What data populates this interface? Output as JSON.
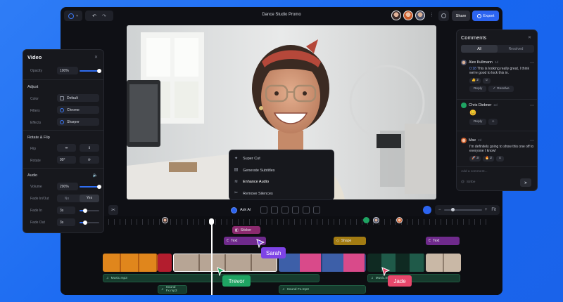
{
  "app": {
    "project_title": "Dance Studio Promo",
    "share_label": "Share",
    "export_label": "Export"
  },
  "ai_menu": {
    "items": [
      {
        "label": "Super Cut",
        "icon": "scissors-sparkle-icon"
      },
      {
        "label": "Generate Subtitles",
        "icon": "subtitles-icon"
      },
      {
        "label": "Enhance Audio",
        "icon": "audio-wave-icon"
      },
      {
        "label": "Remove Silences",
        "icon": "cut-silence-icon"
      }
    ]
  },
  "toolbar": {
    "ask_ai_label": "Ask AI",
    "zoom_minus": "−",
    "zoom_plus": "+",
    "fit_label": "Fit"
  },
  "timeline": {
    "clips": {
      "sticker": "Sticker",
      "text1": "Text",
      "shape": "Shape",
      "text2": "Text",
      "music1": "Music.mp3",
      "music2": "Music.mp3",
      "sfx1": "Sound Fx.mp3",
      "sfx2": "Sound Fx.mp3"
    },
    "cursors": {
      "sarah": "Sarah",
      "trevor": "Trevor",
      "jade": "Jade"
    }
  },
  "video_panel": {
    "title": "Video",
    "opacity_label": "Opacity",
    "opacity_value": "100%",
    "opacity_level": 1.0,
    "adjust_title": "Adjust",
    "color_label": "Color",
    "color_value": "Default",
    "filters_label": "Filters",
    "filters_value": "Chrome",
    "effects_label": "Effects",
    "effects_value": "Sharper",
    "rotate_flip_title": "Rotate & Flip",
    "flip_label": "Flip",
    "rotate_label": "Rotate",
    "rotate_value": "90°",
    "audio_title": "Audio",
    "volume_label": "Volume",
    "volume_value": "200%",
    "volume_level": 1.0,
    "fade_inout_label": "Fade In/Out",
    "fade_no": "No",
    "fade_yes": "Yes",
    "fade_in_label": "Fade In",
    "fade_in_value": "3s",
    "fade_in_level": 0.3,
    "fade_out_label": "Fade Out",
    "fade_out_value": "3s",
    "fade_out_level": 0.3
  },
  "comments": {
    "title": "Comments",
    "tab_all": "All",
    "tab_resolved": "Resolved",
    "entries": [
      {
        "author": "Alex Kullmann",
        "time": "1d",
        "timestamp": "0:18",
        "text": "This is looking really great, I think we're good to lock this in.",
        "reaction": "👍 2"
      },
      {
        "author": "Chris Diebner",
        "time": "2d",
        "emoji": "😊"
      },
      {
        "author": "Max",
        "time": "2d",
        "text": "I'm definitely going to show this one off to everyone I know!",
        "reaction1": "🚀 3",
        "reaction2": "🔥 2"
      }
    ],
    "reply_label": "Reply",
    "resolve_label": "Resolve",
    "input_placeholder": "Add a comment...",
    "footer_label": "Stribe"
  },
  "colors": {
    "accent": "#2c64f0",
    "text_clip": "#6f2a8c",
    "sticker_clip": "#8b2a6e",
    "shape_clip": "#a27b12",
    "audio_clip": "#163b2d",
    "sarah": "#7e43e6",
    "trevor": "#1fa463",
    "jade": "#e8476b"
  }
}
